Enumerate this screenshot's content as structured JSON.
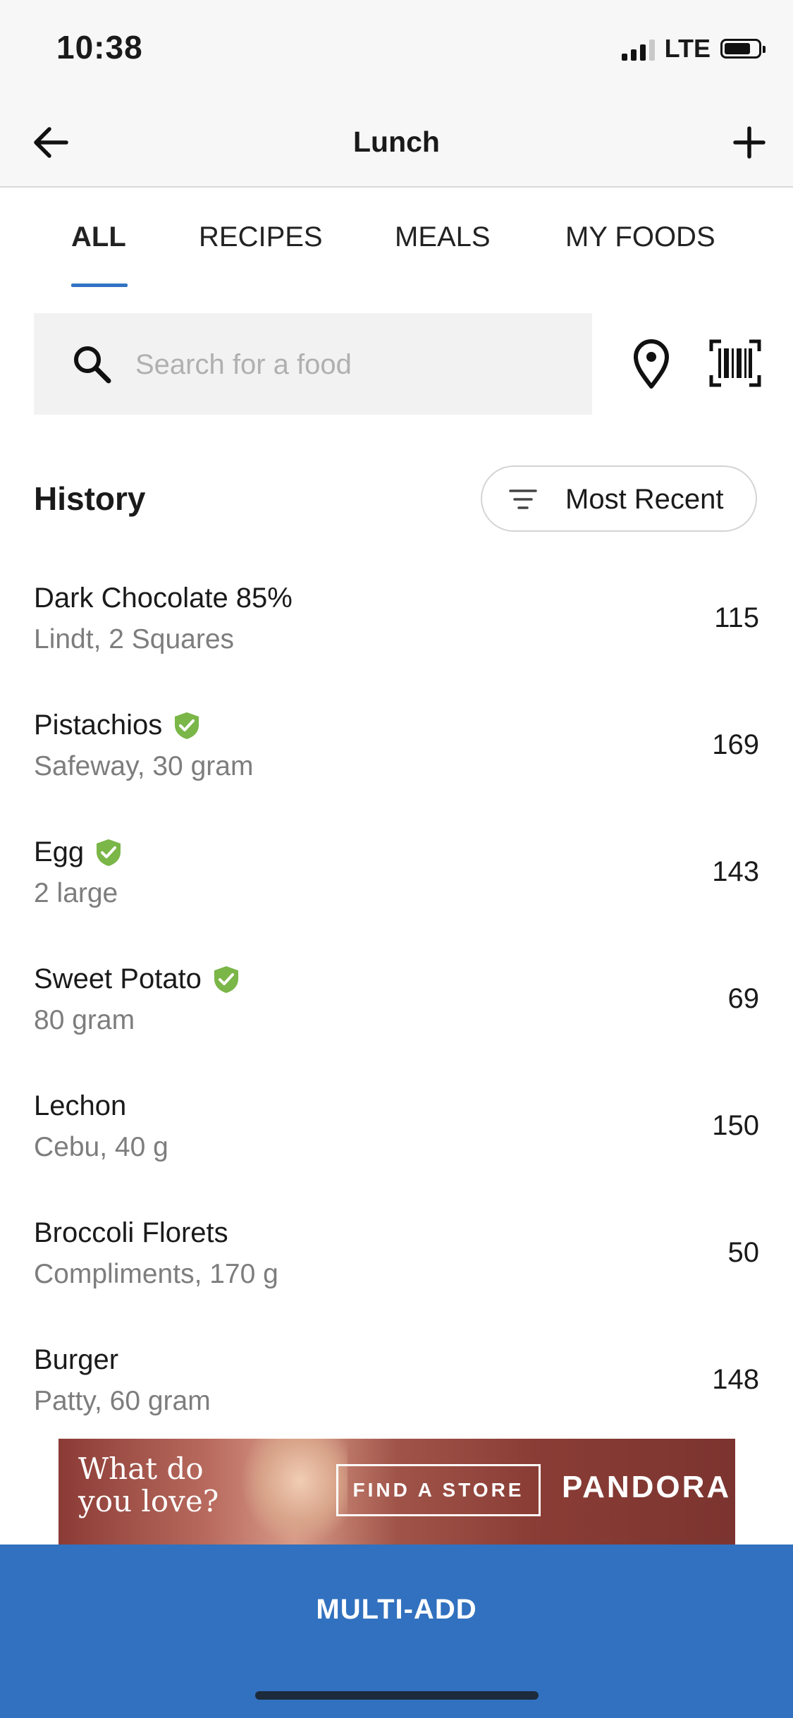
{
  "status_bar": {
    "time": "10:38",
    "network": "LTE"
  },
  "header": {
    "title": "Lunch",
    "back_icon": "arrow-left-icon",
    "add_icon": "plus-icon"
  },
  "tabs": [
    {
      "label": "ALL",
      "active": true
    },
    {
      "label": "RECIPES",
      "active": false
    },
    {
      "label": "MEALS",
      "active": false
    },
    {
      "label": "MY FOODS",
      "active": false
    }
  ],
  "search": {
    "placeholder": "Search for a food",
    "value": ""
  },
  "history": {
    "title": "History",
    "sort_label": "Most Recent"
  },
  "foods": [
    {
      "name": "Dark Chocolate 85%",
      "desc": "Lindt, 2 Squares",
      "calories": "115",
      "verified": false
    },
    {
      "name": "Pistachios",
      "desc": "Safeway, 30 gram",
      "calories": "169",
      "verified": true
    },
    {
      "name": "Egg",
      "desc": "2 large",
      "calories": "143",
      "verified": true
    },
    {
      "name": "Sweet Potato",
      "desc": "80 gram",
      "calories": "69",
      "verified": true
    },
    {
      "name": "Lechon",
      "desc": "Cebu, 40 g",
      "calories": "150",
      "verified": false
    },
    {
      "name": "Broccoli Florets",
      "desc": "Compliments, 170 g",
      "calories": "50",
      "verified": false
    },
    {
      "name": "Burger",
      "desc": "Patty, 60 gram",
      "calories": "148",
      "verified": false
    }
  ],
  "ad": {
    "headline_line1": "What do",
    "headline_line2": "you love?",
    "cta": "FIND A STORE",
    "brand": "PANDORA"
  },
  "footer": {
    "multi_add_label": "MULTI-ADD"
  },
  "colors": {
    "accent": "#3173c4",
    "verified": "#7ab648",
    "footer": "#3171bf"
  }
}
